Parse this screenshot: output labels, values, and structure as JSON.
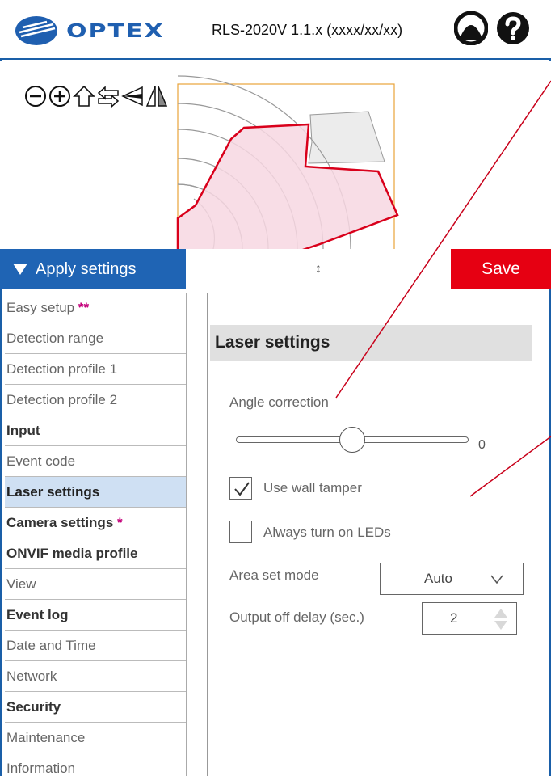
{
  "header": {
    "logo_text": "OPTEX",
    "version": "RLS-2020V 1.1.x (xxxx/xx/xx)",
    "user_icon": "user-icon",
    "help_icon": "help-icon"
  },
  "radar": {
    "tools": [
      "zoom-out-icon",
      "zoom-in-icon",
      "home-icon",
      "swap-arrows-icon",
      "flip-vertical-icon",
      "flip-horizontal-icon"
    ]
  },
  "apply_bar": {
    "apply_label": "Apply settings",
    "resize_glyph": "↕",
    "save_label": "Save"
  },
  "sidebar": {
    "items": [
      {
        "label": "Easy setup",
        "mark": "**"
      },
      {
        "label": "Detection range",
        "mark": ""
      },
      {
        "label": "Detection profile 1",
        "mark": ""
      },
      {
        "label": "Detection profile 2",
        "mark": ""
      },
      {
        "label": "Input",
        "mark": ""
      },
      {
        "label": "Event code",
        "mark": ""
      },
      {
        "label": "Laser settings",
        "mark": ""
      },
      {
        "label": "Camera settings",
        "mark": "*"
      },
      {
        "label": "ONVIF media profile",
        "mark": ""
      },
      {
        "label": "View",
        "mark": ""
      },
      {
        "label": "Event log",
        "mark": ""
      },
      {
        "label": "Date and Time",
        "mark": ""
      },
      {
        "label": "Network",
        "mark": ""
      },
      {
        "label": "Security",
        "mark": ""
      },
      {
        "label": "Maintenance",
        "mark": ""
      },
      {
        "label": "Information",
        "mark": ""
      }
    ],
    "active": "Laser settings"
  },
  "content": {
    "title": "Laser settings",
    "angle_label": "Angle correction",
    "angle_value": "0",
    "wall_tamper_label": "Use wall tamper",
    "wall_tamper_checked": true,
    "leds_label": "Always turn on LEDs",
    "leds_checked": false,
    "area_mode_label": "Area set mode",
    "area_mode_value": "Auto",
    "output_delay_label": "Output off delay (sec.)",
    "output_delay_value": "2"
  },
  "colors": {
    "brand_blue": "#1f64b4",
    "save_red": "#e60012",
    "active_bg": "#cfe0f3",
    "star_magenta": "#c4007a",
    "zone_fill": "#f7d7e2",
    "zone_stroke": "#d9001b"
  }
}
